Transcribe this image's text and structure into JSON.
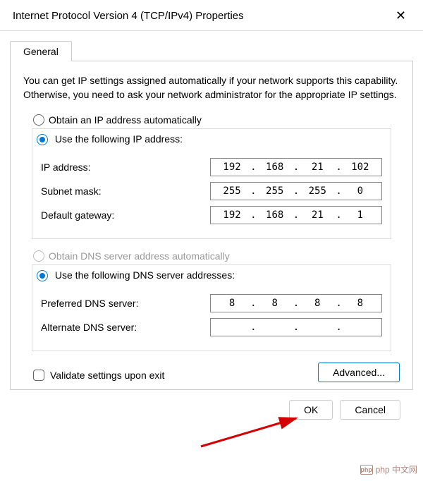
{
  "window": {
    "title": "Internet Protocol Version 4 (TCP/IPv4) Properties",
    "close_icon": "✕"
  },
  "tab": {
    "general": "General"
  },
  "description": "You can get IP settings assigned automatically if your network supports this capability. Otherwise, you need to ask your network administrator for the appropriate IP settings.",
  "ip_section": {
    "auto_label": "Obtain an IP address automatically",
    "manual_label": "Use the following IP address:",
    "ip_label": "IP address:",
    "ip_value": [
      "192",
      "168",
      "21",
      "102"
    ],
    "subnet_label": "Subnet mask:",
    "subnet_value": [
      "255",
      "255",
      "255",
      "0"
    ],
    "gateway_label": "Default gateway:",
    "gateway_value": [
      "192",
      "168",
      "21",
      "1"
    ]
  },
  "dns_section": {
    "auto_label": "Obtain DNS server address automatically",
    "manual_label": "Use the following DNS server addresses:",
    "preferred_label": "Preferred DNS server:",
    "preferred_value": [
      "8",
      "8",
      "8",
      "8"
    ],
    "alternate_label": "Alternate DNS server:",
    "alternate_value": [
      "",
      "",
      "",
      ""
    ]
  },
  "validate_label": "Validate settings upon exit",
  "buttons": {
    "advanced": "Advanced...",
    "ok": "OK",
    "cancel": "Cancel"
  },
  "watermark": "php 中文网"
}
